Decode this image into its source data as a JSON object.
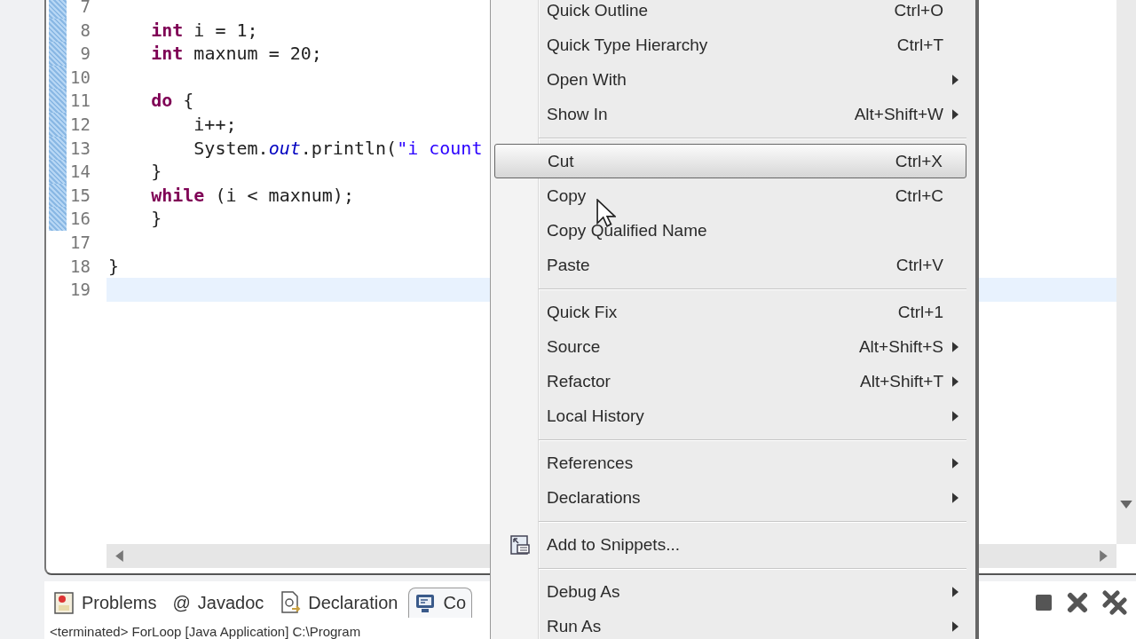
{
  "editor": {
    "lines": [
      {
        "number": "7",
        "changed": true,
        "current": false
      },
      {
        "number": "8",
        "changed": true,
        "current": false,
        "code": [
          {
            "kind": "keyword",
            "text": "    int"
          },
          {
            "kind": "plain",
            "text": " i = 1;"
          }
        ]
      },
      {
        "number": "9",
        "changed": true,
        "current": false,
        "code": [
          {
            "kind": "keyword",
            "text": "    int"
          },
          {
            "kind": "plain",
            "text": " maxnum = 20;"
          }
        ]
      },
      {
        "number": "10",
        "changed": true,
        "current": false
      },
      {
        "number": "11",
        "changed": true,
        "current": false,
        "code": [
          {
            "kind": "keyword",
            "text": "    do"
          },
          {
            "kind": "plain",
            "text": " {"
          }
        ]
      },
      {
        "number": "12",
        "changed": true,
        "current": false,
        "code": [
          {
            "kind": "plain",
            "text": "        i++;"
          }
        ]
      },
      {
        "number": "13",
        "changed": true,
        "current": false,
        "code": [
          {
            "kind": "plain",
            "text": "        System."
          },
          {
            "kind": "field",
            "text": "out"
          },
          {
            "kind": "plain",
            "text": ".println("
          },
          {
            "kind": "string",
            "text": "\"i count"
          }
        ]
      },
      {
        "number": "14",
        "changed": true,
        "current": false,
        "code": [
          {
            "kind": "plain",
            "text": "    }"
          }
        ]
      },
      {
        "number": "15",
        "changed": true,
        "current": false,
        "code": [
          {
            "kind": "keyword",
            "text": "    while"
          },
          {
            "kind": "plain",
            "text": " (i < maxnum);"
          }
        ]
      },
      {
        "number": "16",
        "changed": true,
        "current": false,
        "code": [
          {
            "kind": "plain",
            "text": "    }"
          }
        ]
      },
      {
        "number": "17",
        "changed": false,
        "current": false
      },
      {
        "number": "18",
        "changed": false,
        "current": false,
        "code": [
          {
            "kind": "plain",
            "text": "}"
          }
        ]
      },
      {
        "number": "19",
        "changed": false,
        "current": true
      }
    ]
  },
  "context_menu": {
    "groups": [
      {
        "items": [
          {
            "label": "Quick Outline",
            "shortcut": "Ctrl+O",
            "submenu": false,
            "selected": false,
            "icon": false
          },
          {
            "label": "Quick Type Hierarchy",
            "shortcut": "Ctrl+T",
            "submenu": false,
            "selected": false,
            "icon": false
          },
          {
            "label": "Open With",
            "submenu": true,
            "selected": false,
            "icon": false
          },
          {
            "label": "Show In",
            "shortcut": "Alt+Shift+W",
            "submenu": true,
            "selected": false,
            "icon": false
          }
        ]
      },
      {
        "items": [
          {
            "label": "Cut",
            "shortcut": "Ctrl+X",
            "submenu": false,
            "selected": true,
            "icon": false
          },
          {
            "label": "Copy",
            "shortcut": "Ctrl+C",
            "submenu": false,
            "selected": false,
            "icon": false
          },
          {
            "label": "Copy Qualified Name",
            "submenu": false,
            "selected": false,
            "icon": false
          },
          {
            "label": "Paste",
            "shortcut": "Ctrl+V",
            "submenu": false,
            "selected": false,
            "icon": false
          }
        ]
      },
      {
        "items": [
          {
            "label": "Quick Fix",
            "shortcut": "Ctrl+1",
            "submenu": false,
            "selected": false,
            "icon": false
          },
          {
            "label": "Source",
            "shortcut": "Alt+Shift+S",
            "submenu": true,
            "selected": false,
            "icon": false
          },
          {
            "label": "Refactor",
            "shortcut": "Alt+Shift+T",
            "submenu": true,
            "selected": false,
            "icon": false
          },
          {
            "label": "Local History",
            "submenu": true,
            "selected": false,
            "icon": false
          }
        ]
      },
      {
        "items": [
          {
            "label": "References",
            "submenu": true,
            "selected": false,
            "icon": false
          },
          {
            "label": "Declarations",
            "submenu": true,
            "selected": false,
            "icon": false
          }
        ]
      },
      {
        "items": [
          {
            "label": "Add to Snippets...",
            "submenu": false,
            "selected": false,
            "icon": true
          }
        ]
      },
      {
        "items": [
          {
            "label": "Debug As",
            "submenu": true,
            "selected": false,
            "icon": false
          },
          {
            "label": "Run As",
            "submenu": true,
            "selected": false,
            "icon": false
          }
        ]
      }
    ]
  },
  "bottom_panel": {
    "tabs": [
      {
        "kind": "problems",
        "label": "Problems",
        "selected": false
      },
      {
        "kind": "javadoc",
        "glyph": "@",
        "label": "Javadoc",
        "selected": false
      },
      {
        "kind": "declaration",
        "label": "Declaration",
        "selected": false
      },
      {
        "kind": "console",
        "label": "Co",
        "selected": true
      }
    ],
    "console_text": "<terminated> ForLoop [Java Application] C:\\Program"
  }
}
